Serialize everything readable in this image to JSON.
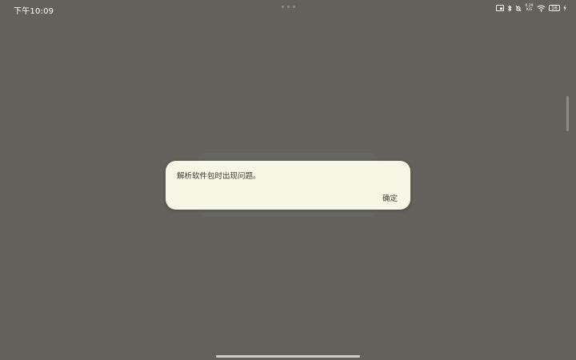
{
  "status_bar": {
    "time": "下午10:09",
    "net_speed_value": "0.29",
    "net_speed_unit": "K/S",
    "battery_level": "16",
    "icons": [
      "tablet-icon",
      "bluetooth-icon",
      "silent-icon",
      "data-speed-icon",
      "wifi-icon",
      "battery-icon",
      "charging-icon"
    ]
  },
  "dialog": {
    "message": "解析软件包时出现问题。",
    "confirm_label": "确定"
  },
  "colors": {
    "background_dim": "#63615c",
    "dialog_bg": "#f6f8e5",
    "dialog_text": "#3b3a35"
  }
}
